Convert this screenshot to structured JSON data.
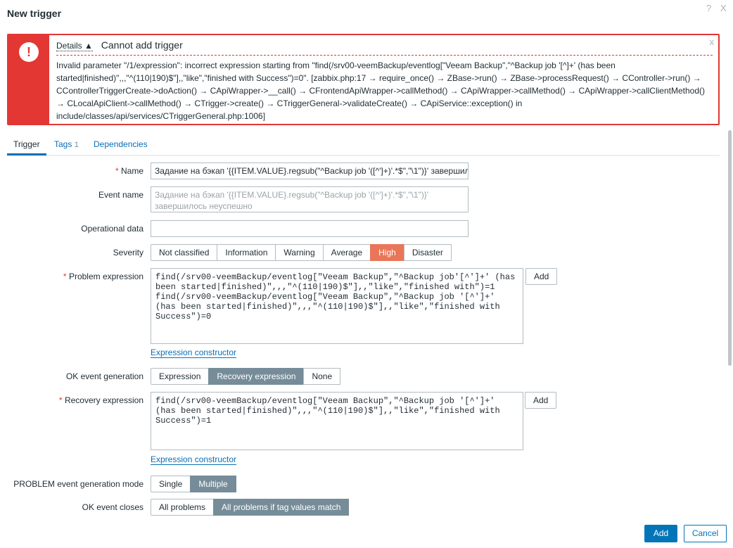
{
  "dialog": {
    "title": "New trigger",
    "help_icon": "?",
    "close_icon": "X"
  },
  "error": {
    "details_label": "Details ▲",
    "title": "Cannot add trigger",
    "icon": "!",
    "close": "x",
    "message": "Invalid parameter \"/1/expression\": incorrect expression starting from \"find(/srv00-veemBackup/eventlog[\"Veeam Backup\",\"^Backup job '[^]+' (has been started|finished)\",,,\"^(110|190)$\"],,\"like\",\"finished with Success\")=0\". [zabbix.php:17 → require_once() → ZBase->run() → ZBase->processRequest() → CController->run() → CControllerTriggerCreate->doAction() → CApiWrapper->__call() → CFrontendApiWrapper->callMethod() → CApiWrapper->callMethod() → CApiWrapper->callClientMethod() → CLocalApiClient->callMethod() → CTrigger->create() → CTriggerGeneral->validateCreate() → CApiService::exception() in include/classes/api/services/CTriggerGeneral.php:1006]"
  },
  "tabs": [
    {
      "label": "Trigger"
    },
    {
      "label": "Tags",
      "count": "1"
    },
    {
      "label": "Dependencies"
    }
  ],
  "form": {
    "name": {
      "label": "Name",
      "value": "Задание на бэкап '{{ITEM.VALUE}.regsub(\"^Backup job '([^']+)'.*$\",\"\\1\")}' завершилось неуспешно"
    },
    "event_name": {
      "label": "Event name",
      "placeholder": "Задание на бэкап '{{ITEM.VALUE}.regsub(\"^Backup job '([^']+)'.*$\",\"\\1\")}' завершилось неуспешно"
    },
    "operational_data": {
      "label": "Operational data",
      "value": ""
    },
    "severity": {
      "label": "Severity",
      "options": [
        "Not classified",
        "Information",
        "Warning",
        "Average",
        "High",
        "Disaster"
      ],
      "selected": "High"
    },
    "problem_expression": {
      "label": "Problem expression",
      "value": "find(/srv00-veemBackup/eventlog[\"Veeam Backup\",\"^Backup job'[^']+' (has been started|finished)\",,,\"^(110|190)$\"],,\"like\",\"finished with\")=1\nfind(/srv00-veemBackup/eventlog[\"Veeam Backup\",\"^Backup job '[^']+' (has been started|finished)\",,,\"^(110|190)$\"],,\"like\",\"finished with Success\")=0",
      "add": "Add",
      "constructor": "Expression constructor"
    },
    "ok_event_generation": {
      "label": "OK event generation",
      "options": [
        "Expression",
        "Recovery expression",
        "None"
      ],
      "selected": "Recovery expression"
    },
    "recovery_expression": {
      "label": "Recovery expression",
      "value": "find(/srv00-veemBackup/eventlog[\"Veeam Backup\",\"^Backup job '[^']+' (has been started|finished)\",,,\"^(110|190)$\"],,\"like\",\"finished with Success\")=1",
      "add": "Add",
      "constructor": "Expression constructor"
    },
    "problem_mode": {
      "label": "PROBLEM event generation mode",
      "options": [
        "Single",
        "Multiple"
      ],
      "selected": "Multiple"
    },
    "ok_closes": {
      "label": "OK event closes",
      "options": [
        "All problems",
        "All problems if tag values match"
      ],
      "selected": "All problems if tag values match"
    }
  },
  "footer": {
    "add": "Add",
    "cancel": "Cancel"
  }
}
